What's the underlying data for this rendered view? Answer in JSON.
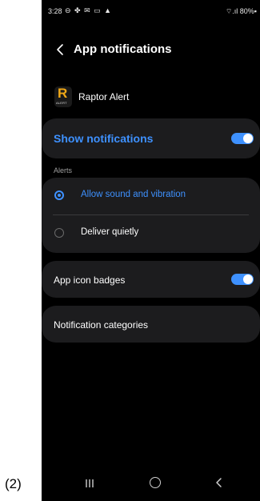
{
  "caption": "(2)",
  "status_bar": {
    "time": "3:28",
    "left_icons": "⊖ ✤ ✉ ▭ ▲",
    "right_text": "⌔.ıl 80%▪"
  },
  "header": {
    "title": "App notifications"
  },
  "app": {
    "name": "Raptor Alert",
    "icon_letter": "R",
    "icon_subtext": "ALERT"
  },
  "show_notifications": {
    "label": "Show notifications",
    "enabled": true
  },
  "alerts": {
    "section_label": "Alerts",
    "options": [
      {
        "label": "Allow sound and vibration",
        "selected": true
      },
      {
        "label": "Deliver quietly",
        "selected": false
      }
    ]
  },
  "app_icon_badges": {
    "label": "App icon badges",
    "enabled": true
  },
  "notification_categories": {
    "label": "Notification categories"
  },
  "colors": {
    "accent": "#3e91ff",
    "background": "#000000",
    "card": "#1c1c1e",
    "app_icon_letter": "#f0a817"
  },
  "icons": [
    "back-arrow-icon",
    "app-icon",
    "wifi-icon",
    "signal-icon",
    "battery-icon",
    "recent-apps-icon",
    "home-icon",
    "nav-back-icon"
  ]
}
